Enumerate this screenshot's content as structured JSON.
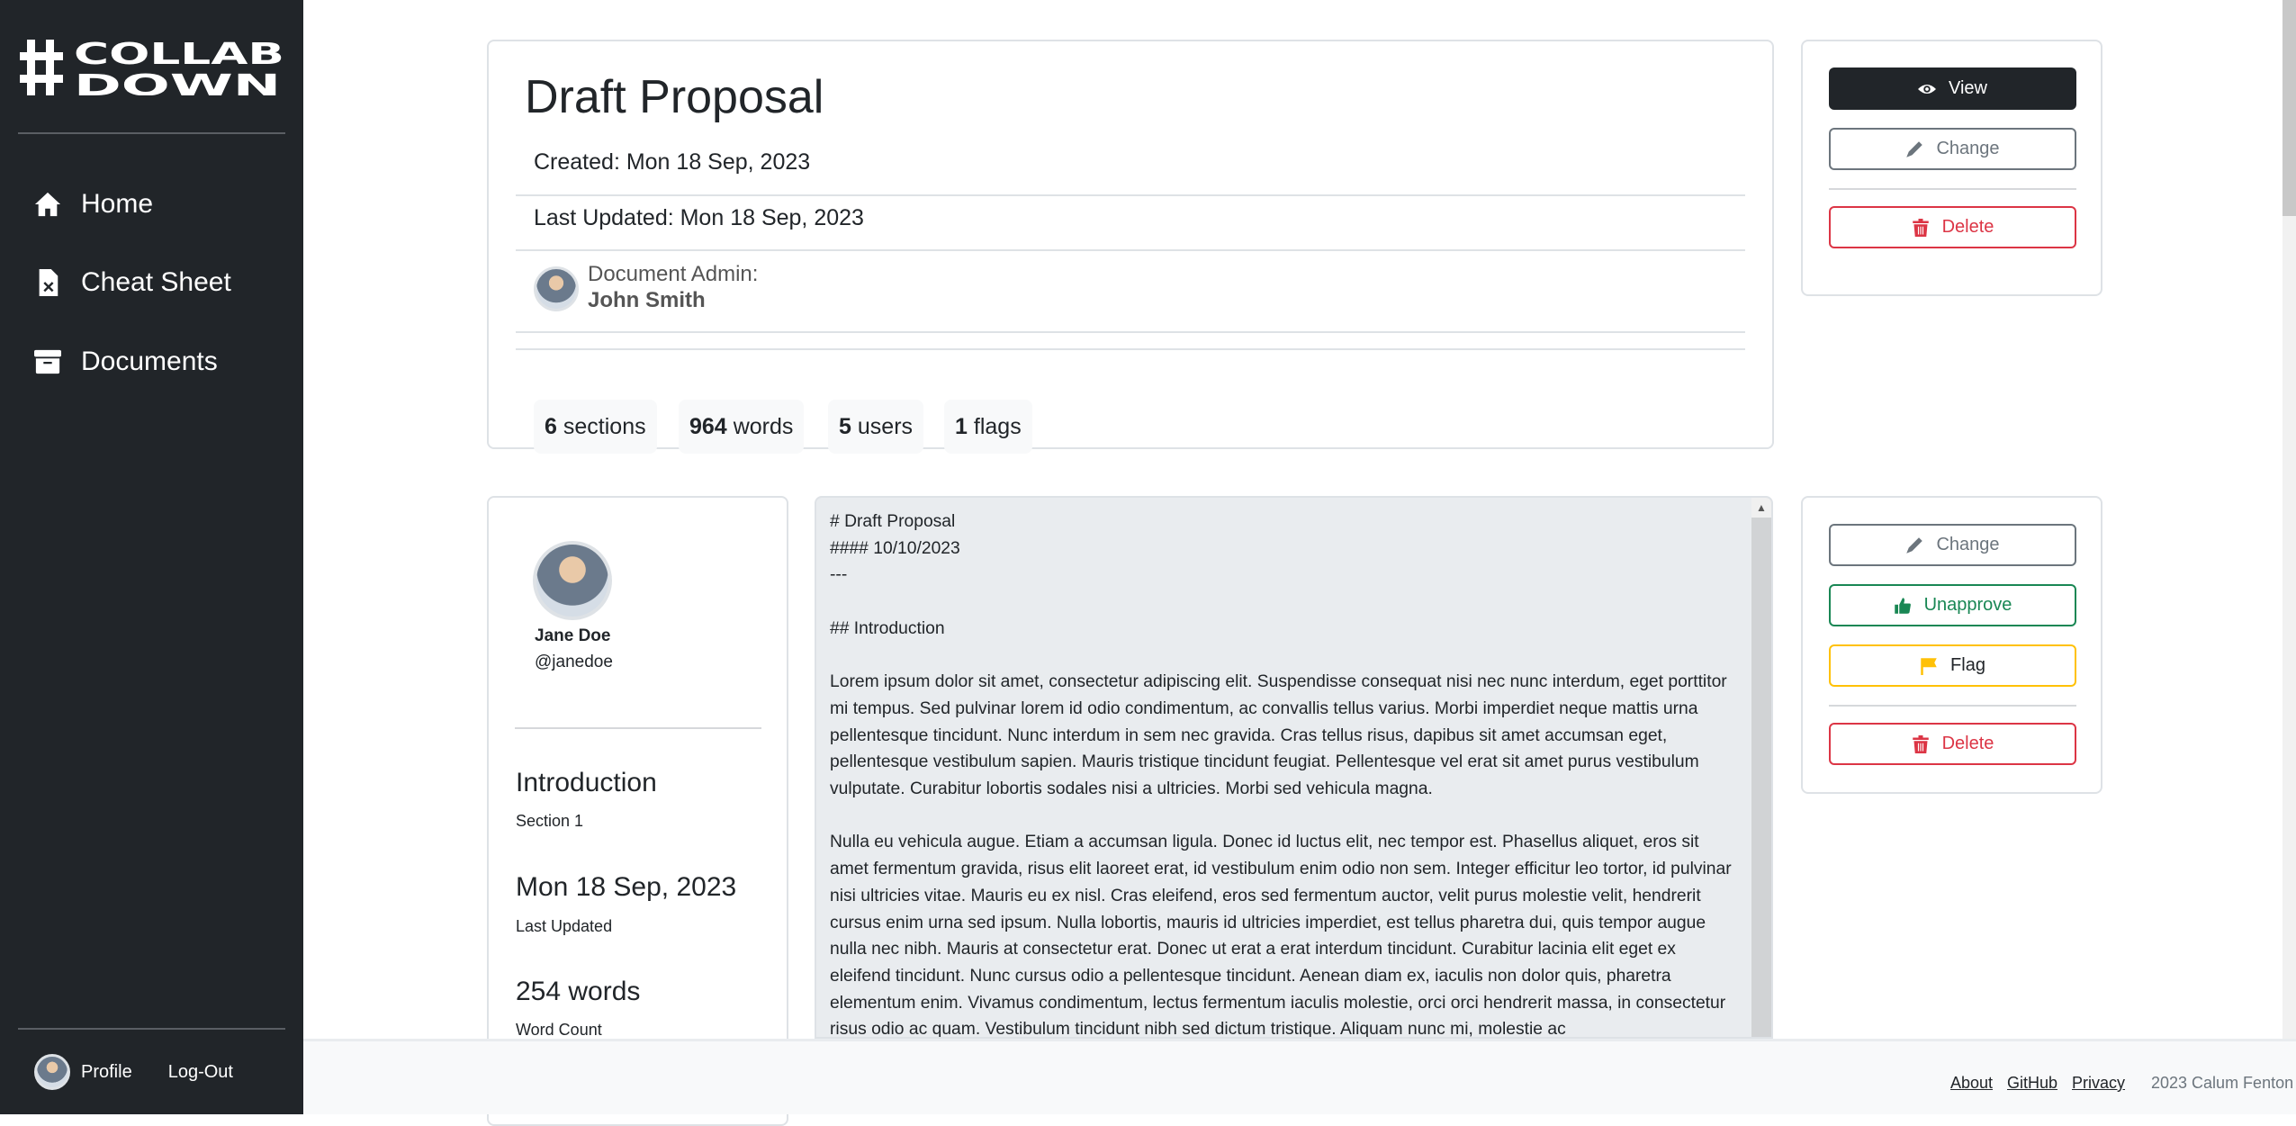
{
  "sidebar": {
    "logo_text": "#COLLAB DOWN",
    "nav": [
      {
        "label": "Home",
        "icon": "home-icon"
      },
      {
        "label": "Cheat Sheet",
        "icon": "file-x-icon"
      },
      {
        "label": "Documents",
        "icon": "archive-icon"
      }
    ],
    "profile_label": "Profile",
    "logout_label": "Log-Out"
  },
  "document": {
    "title": "Draft Proposal",
    "created": "Created: Mon 18 Sep, 2023",
    "last_updated": "Last Updated: Mon 18 Sep, 2023",
    "admin_label": "Document Admin:",
    "admin_name": "John Smith",
    "stats": [
      {
        "value": "6",
        "label": "sections"
      },
      {
        "value": "964",
        "label": "words"
      },
      {
        "value": "5",
        "label": "users"
      },
      {
        "value": "1",
        "label": "flags"
      }
    ]
  },
  "doc_actions": {
    "view": "View",
    "change": "Change",
    "delete": "Delete"
  },
  "section": {
    "author_name": "Jane Doe",
    "author_handle": "@janedoe",
    "title": "Introduction",
    "subtitle": "Section 1",
    "date": "Mon 18 Sep, 2023",
    "date_label": "Last Updated",
    "words": "254 words",
    "words_label": "Word Count",
    "content": "# Draft Proposal\n#### 10/10/2023\n---\n\n## Introduction\n\nLorem ipsum dolor sit amet, consectetur adipiscing elit. Suspendisse consequat nisi nec nunc interdum, eget porttitor mi tempus. Sed pulvinar lorem id odio condimentum, ac convallis tellus varius. Morbi imperdiet neque mattis urna pellentesque tincidunt. Nunc interdum in sem nec gravida. Cras tellus risus, dapibus sit amet accumsan eget, pellentesque vestibulum sapien. Mauris tristique tincidunt feugiat. Pellentesque vel erat sit amet purus vestibulum vulputate. Curabitur lobortis sodales nisi a ultricies. Morbi sed vehicula magna.\n\nNulla eu vehicula augue. Etiam a accumsan ligula. Donec id luctus elit, nec tempor est. Phasellus aliquet, eros sit amet fermentum gravida, risus elit laoreet erat, id vestibulum enim odio non sem. Integer efficitur leo tortor, id pulvinar nisi ultricies vitae. Mauris eu ex nisl. Cras eleifend, eros sed fermentum auctor, velit purus molestie velit, hendrerit cursus enim urna sed ipsum. Nulla lobortis, mauris id ultricies imperdiet, est tellus pharetra dui, quis tempor augue nulla nec nibh. Mauris at consectetur erat. Donec ut erat a erat interdum tincidunt. Curabitur lacinia elit eget ex eleifend tincidunt. Nunc cursus odio a pellentesque tincidunt. Aenean diam ex, iaculis non dolor quis, pharetra elementum enim. Vivamus condimentum, lectus fermentum iaculis molestie, orci orci hendrerit massa, in consectetur risus odio ac quam. Vestibulum tincidunt nibh sed dictum tristique. Aliquam nunc mi, molestie ac"
  },
  "section_actions": {
    "change": "Change",
    "unapprove": "Unapprove",
    "flag": "Flag",
    "delete": "Delete"
  },
  "footer": {
    "links": [
      "About",
      "GitHub",
      "Privacy"
    ],
    "copyright": "2023 Calum Fenton"
  },
  "colors": {
    "sidebar": "#212529",
    "danger": "#dc3545",
    "success": "#198754",
    "warning": "#ffc107",
    "secondary": "#6c757d"
  }
}
